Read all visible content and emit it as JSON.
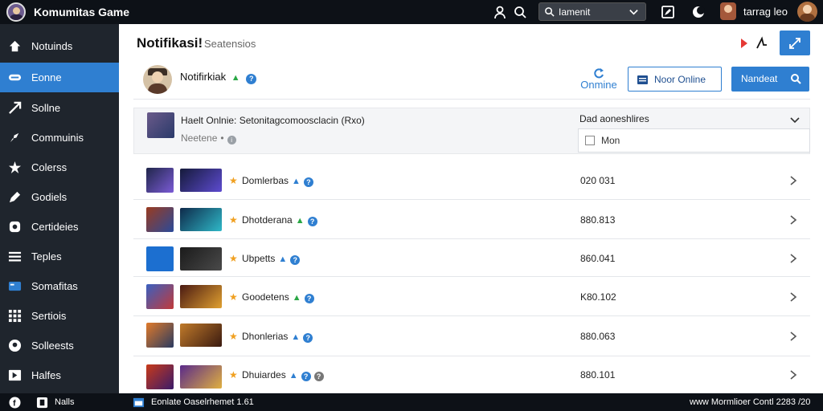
{
  "app": {
    "title": "Komumitas Game",
    "top_icons": [
      "person-icon",
      "search-icon",
      "search-icon",
      "chevron-down-icon",
      "edit-icon",
      "moon-icon"
    ],
    "search": {
      "value": "Iamenit"
    },
    "user": {
      "name": "tarrag leo"
    }
  },
  "sidebar": {
    "items": [
      {
        "label": "Notuinds",
        "icon": "home-icon",
        "active": false
      },
      {
        "label": "Eonne",
        "icon": "game-icon",
        "active": true
      },
      {
        "label": "Sollne",
        "icon": "arrow-icon",
        "active": false
      },
      {
        "label": "Commuinis",
        "icon": "tag-icon",
        "active": false
      },
      {
        "label": "Colerss",
        "icon": "star-icon",
        "active": false
      },
      {
        "label": "Godiels",
        "icon": "edit-icon",
        "active": false
      },
      {
        "label": "Certideies",
        "icon": "shield-icon",
        "active": false
      },
      {
        "label": "Teples",
        "icon": "list-icon",
        "active": false
      },
      {
        "label": "Somafitas",
        "icon": "screen-icon",
        "active": false
      },
      {
        "label": "Sertiois",
        "icon": "grid-icon",
        "active": false
      },
      {
        "label": "Solleests",
        "icon": "face-icon",
        "active": false
      },
      {
        "label": "Halfes",
        "icon": "video-icon",
        "active": false
      }
    ]
  },
  "main": {
    "title": "Notifikasi!",
    "subtitle": "Seatensios",
    "profile": {
      "name": "Notifirkiak",
      "online_label": "Onmine",
      "btn_outline": "Noor Online",
      "btn_primary": "Nandeat"
    },
    "featured": {
      "title": "Haelt Onlnie: Setonitagcomoosclacin (Rxo)",
      "meta": "Neetene",
      "dropdown_label": "Dad aoneshlires",
      "dropdown_value": "Mon"
    },
    "rows": [
      {
        "name": "Domlerbas",
        "value": "020 031",
        "level_color": "#2f7fd1",
        "thumb1": [
          "#20264a",
          "#7b5bd6"
        ],
        "thumb2": [
          "#151a3a",
          "#5d4bd0"
        ],
        "extra_info": false
      },
      {
        "name": "Dhotderana",
        "value": "880.813",
        "level_color": "#2aa745",
        "thumb1": [
          "#9a3b20",
          "#2a4a9a"
        ],
        "thumb2": [
          "#0e2a4a",
          "#2fb8c8"
        ],
        "extra_info": false
      },
      {
        "name": "Ubpetts",
        "value": "860.041",
        "level_color": "#2f7fd1",
        "thumb1": [
          "#1c6fd0",
          "#1c6fd0"
        ],
        "thumb2": [
          "#1a1a1a",
          "#4a4a4a"
        ],
        "extra_info": false
      },
      {
        "name": "Goodetens",
        "value": "K80.102",
        "level_color": "#2aa745",
        "thumb1": [
          "#3a60c0",
          "#c23a3a"
        ],
        "thumb2": [
          "#4a1a12",
          "#e0a030"
        ],
        "extra_info": false
      },
      {
        "name": "Dhonlerias",
        "value": "880.063",
        "level_color": "#2f7fd1",
        "thumb1": [
          "#e07a2a",
          "#2a3a60"
        ],
        "thumb2": [
          "#c07a2a",
          "#3a1a10"
        ],
        "extra_info": false
      },
      {
        "name": "Dhuiardes",
        "value": "880.101",
        "level_color": "#2f7fd1",
        "thumb1": [
          "#c83a1a",
          "#3a1a6a"
        ],
        "thumb2": [
          "#5a2a8a",
          "#e0b040"
        ],
        "extra_info": true
      }
    ]
  },
  "bottombar": {
    "left": "Nalls",
    "middle": "Eonlate Oaselrhemet 1.61",
    "right": "www Mormlioer Contl 2283 /20"
  }
}
